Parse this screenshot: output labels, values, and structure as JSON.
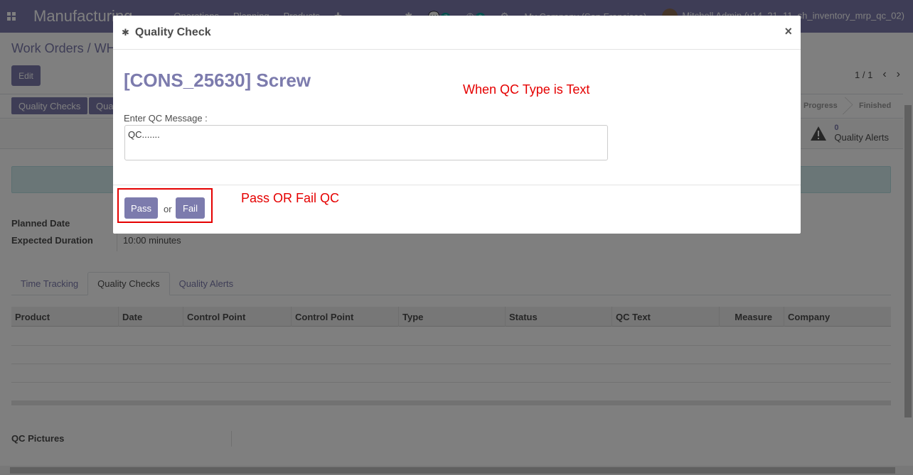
{
  "navbar": {
    "brand": "Manufacturing",
    "menu": [
      "Operations",
      "Planning",
      "Products"
    ],
    "badge_chat": "7",
    "badge_activity": "6",
    "company": "My Company (San Francisco)",
    "user": "Mitchell Admin (v14_21_11_sh_inventory_mrp_qc_02)"
  },
  "control": {
    "breadcrumb": "Work Orders / WH",
    "edit_label": "Edit",
    "pager_value": "1 / 1",
    "prev_icon": "‹",
    "next_icon": "›"
  },
  "statusbar": {
    "btn_quality_checks": "Quality Checks",
    "btn_quality_alert": "Qua",
    "stage_progress": "Progress",
    "stage_finished": "Finished"
  },
  "smart_button": {
    "count": "0",
    "label": "Quality Alerts"
  },
  "fields": {
    "planned_date_label": "Planned Date",
    "expected_duration_label": "Expected Duration",
    "expected_duration_value": "10:00 minutes"
  },
  "tabs": [
    "Time Tracking",
    "Quality Checks",
    "Quality Alerts"
  ],
  "table": {
    "columns": [
      "Product",
      "Date",
      "Control Point",
      "Control Point",
      "Type",
      "Status",
      "QC Text",
      "Measure",
      "Company"
    ]
  },
  "qc_pictures_label": "QC Pictures",
  "modal": {
    "title": "Quality Check",
    "close": "×",
    "product_title": "[CONS_25630] Screw",
    "annotation_type": "When QC Type is Text",
    "message_label": "Enter QC Message :",
    "message_value": "QC.......",
    "pass_label": "Pass",
    "or_label": "or",
    "fail_label": "Fail",
    "annotation_pass_fail": "Pass OR Fail QC"
  },
  "colors": {
    "primary": "#7c7bad",
    "annotation": "#e50000",
    "badge": "#00a09d"
  }
}
